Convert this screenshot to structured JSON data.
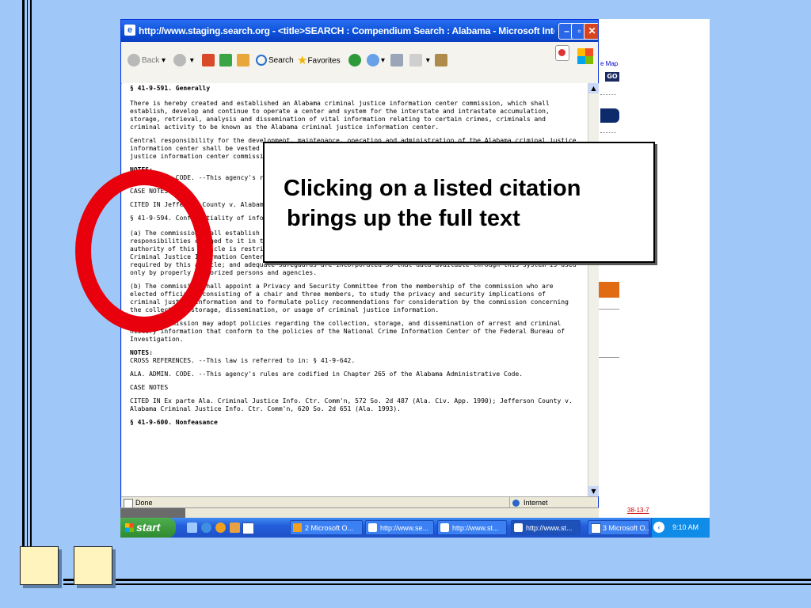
{
  "browser": {
    "title": "http://www.staging.search.org - <title>SEARCH : Compendium Search : Alabama - Microsoft Internet Explorer",
    "toolbar": {
      "back_label": "Back",
      "search_label": "Search",
      "favorites_label": "Favorites"
    },
    "status": {
      "left": "Done",
      "zone": "Internet"
    }
  },
  "document": {
    "heading1": "§ 41-9-591. Generally",
    "para1": "There is hereby created and established an Alabama criminal justice information center commission, which shall establish, develop and continue to operate a center and system for the interstate and intrastate accumulation, storage, retrieval, analysis and dissemination of vital information relating to certain crimes, criminals and criminal activity to be known as the Alabama criminal justice information center.",
    "para2": "Central responsibility for the development, maintenance, operation and administration of the Alabama criminal justice information center shall be vested with the director of the ACJIC under the supervision of the Alabama criminal justice information center commission.",
    "notes1_label": "NOTES:",
    "notes1_text": "ALA. ADMIN. CODE. --This agency's rules are codified in Chapter 265 of the Alabama Administrative Code.",
    "case_notes1": "CASE NOTES",
    "cited1": "CITED IN Jefferson County v. Alabama Criminal Justice Info. Ctr. Comm'n, 620 So. 2d 651 (Ala. 1993).",
    "heading2": "§ 41-9-594. Confidentiality of information -- Privacy and security committee",
    "para_a": "(a) The commission shall establish its own rules, regulations, and policies for the performance of the responsibilities charged to it in this article. The commission shall ensure that: the information obtained under authority of this article is restricted to the items germane to the implementation of this article; the Alabama Criminal Justice Information Center is administered so as not to accumulate or distribute any information not required by this article; and adequate safeguards are incorporated so that data available through this system is used only by properly authorized persons and agencies.",
    "para_b": "(b) The commission shall appoint a Privacy and Security Committee from the membership of the commission who are elected officials, consisting of a chair and three members, to study the privacy and security implications of criminal justice information and to formulate policy recommendations for consideration by the commission concerning the collection, storage, dissemination, or usage of criminal justice information.",
    "para_c": "(c) The commission may adopt policies regarding the collection, storage, and dissemination of arrest and criminal history information that conform to the policies of the National Crime Information Center of the Federal Bureau of Investigation.",
    "notes2_label": "NOTES:",
    "notes2_text": "CROSS REFERENCES. --This law is referred to in: § 41-9-642.",
    "notes2_admin": "ALA. ADMIN. CODE. --This agency's rules are codified in Chapter 265 of the Alabama Administrative Code.",
    "case_notes2": "CASE NOTES",
    "cited2": "CITED IN Ex parte Ala. Criminal Justice Info. Ctr. Comm'n, 572 So. 2d 487 (Ala. Civ. App. 1990); Jefferson County v. Alabama Criminal Justice Info. Ctr. Comm'n, 620 So. 2d 651 (Ala. 1993).",
    "heading3": "§ 41-9-600. Nonfeasance"
  },
  "background_window": {
    "link_partial": "e Map",
    "go_label": "GO",
    "link_bottom": "38-13-7"
  },
  "taskbar": {
    "start_label": "start",
    "tasks": [
      "2 Microsoft O...",
      "http://www.se...",
      "http://www.st...",
      "http://www.st...",
      "3 Microsoft O..."
    ],
    "clock": "9:10 AM"
  },
  "callout": {
    "line1": "Clicking on a listed citation",
    "line2": "brings up the full text"
  },
  "colors": {
    "slide_background": "#9fc8f8",
    "highlight_circle": "#e8000c",
    "xp_blue": "#245edb"
  }
}
